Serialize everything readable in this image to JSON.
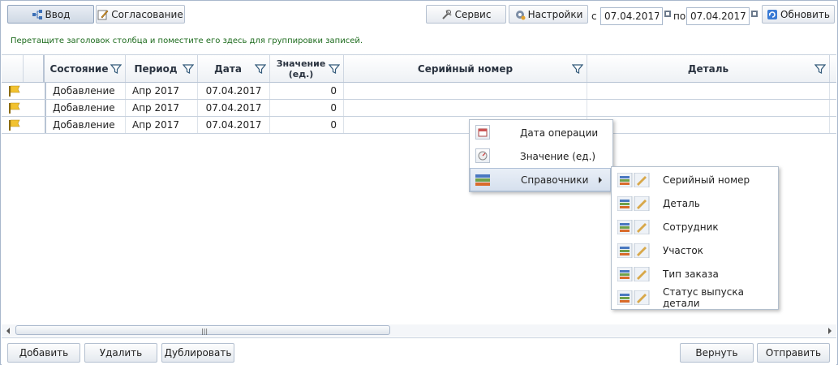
{
  "toolbar": {
    "input_label": "Ввод",
    "approval_label": "Согласование",
    "service_label": "Сервис",
    "settings_label": "Настройки",
    "from_label": "с",
    "from_date": "07.04.2017",
    "to_label": "по",
    "to_date": "07.04.2017",
    "refresh_label": "Обновить"
  },
  "group_hint": "Перетащите заголовок столбца и поместите его здесь для группировки записей.",
  "grid": {
    "columns": {
      "status": "Состояние",
      "period": "Период",
      "date": "Дата",
      "value_line1": "Значение",
      "value_line2": "(ед.)",
      "serial": "Серийный номер",
      "detail": "Деталь"
    },
    "rows": [
      {
        "status": "Добавление",
        "period": "Апр 2017",
        "date": "07.04.2017",
        "value": "0"
      },
      {
        "status": "Добавление",
        "period": "Апр 2017",
        "date": "07.04.2017",
        "value": "0"
      },
      {
        "status": "Добавление",
        "period": "Апр 2017",
        "date": "07.04.2017",
        "value": "0"
      }
    ]
  },
  "context_menu": {
    "items": [
      "Дата операции",
      "Значение (ед.)",
      "Справочники"
    ]
  },
  "submenu": {
    "items": [
      "Серийный номер",
      "Деталь",
      "Сотрудник",
      "Участок",
      "Тип заказа",
      "Статус выпуска детали"
    ]
  },
  "bottom": {
    "add": "Добавить",
    "delete": "Удалить",
    "duplicate": "Дублировать",
    "return": "Вернуть",
    "send": "Отправить"
  },
  "colors": {
    "accent_border": "#a9b8cc",
    "hint_text": "#1d6b1d",
    "flag": "#f2c230"
  }
}
